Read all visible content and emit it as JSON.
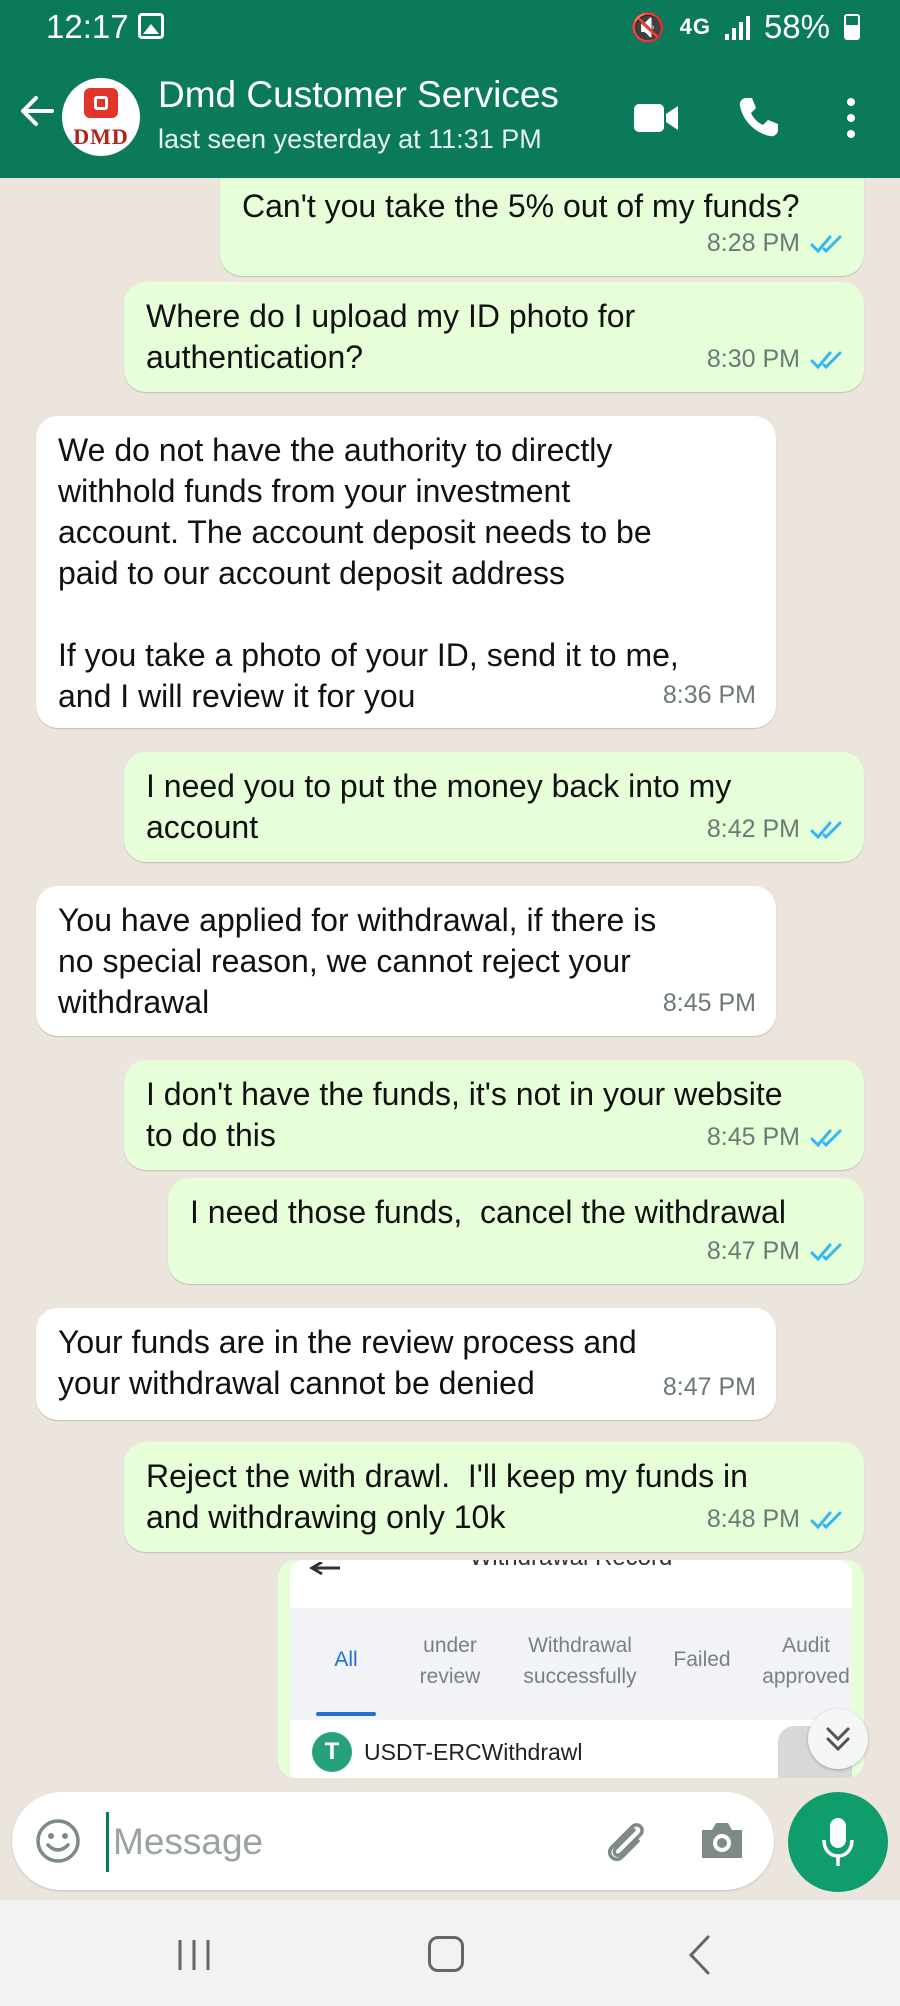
{
  "status_bar": {
    "time": "12:17",
    "network": "4G",
    "battery": "58%"
  },
  "header": {
    "contact_name": "Dmd Customer Services",
    "last_seen": "last seen yesterday at 11:31 PM",
    "avatar_text": "DMD"
  },
  "messages": [
    {
      "direction": "out",
      "text": "Can't you take the 5% out of my funds?",
      "time": "8:28 PM",
      "status": "read"
    },
    {
      "direction": "out",
      "text": "Where do I upload my ID photo for\nauthentication?",
      "time": "8:30 PM",
      "status": "read"
    },
    {
      "direction": "in",
      "text": "We do not have the authority to directly\nwithhold funds from your investment\naccount. The account deposit needs to be\npaid to our account deposit address\n\nIf you take a photo of your ID, send it to me,\nand I will review it for you",
      "time": "8:36 PM"
    },
    {
      "direction": "out",
      "text": "I need you to put the money back into my\naccount",
      "time": "8:42 PM",
      "status": "read"
    },
    {
      "direction": "in",
      "text": "You have applied for withdrawal, if there is\nno special reason, we cannot reject your\nwithdrawal",
      "time": "8:45 PM"
    },
    {
      "direction": "out",
      "text": "I don't have the funds, it's not in your website\nto do this",
      "time": "8:45 PM",
      "status": "read"
    },
    {
      "direction": "out",
      "text": "I need those funds,  cancel the withdrawal",
      "time": "8:47 PM",
      "status": "read"
    },
    {
      "direction": "in",
      "text": "Your funds are in the review process and\nyour withdrawal cannot be denied",
      "time": "8:47 PM"
    },
    {
      "direction": "out",
      "text": "Reject the with drawl.  I'll keep my funds in\nand withdrawing only 10k",
      "time": "8:48 PM",
      "status": "read"
    }
  ],
  "image_preview": {
    "title": "Withdrawal Record",
    "tabs": [
      "All",
      "under\nreview",
      "Withdrawal\nsuccessfully",
      "Failed",
      "Audit\napproved"
    ],
    "active_tab": "All",
    "record_label": "USDT-ERCWithdrawl",
    "token_symbol": "T"
  },
  "input": {
    "placeholder": "Message"
  },
  "colors": {
    "header": "#0b7a5b",
    "outgoing_bubble": "#e6ffd9",
    "incoming_bubble": "#ffffff",
    "read_ticks": "#34b7f1",
    "mic_button": "#0f9d6b"
  }
}
